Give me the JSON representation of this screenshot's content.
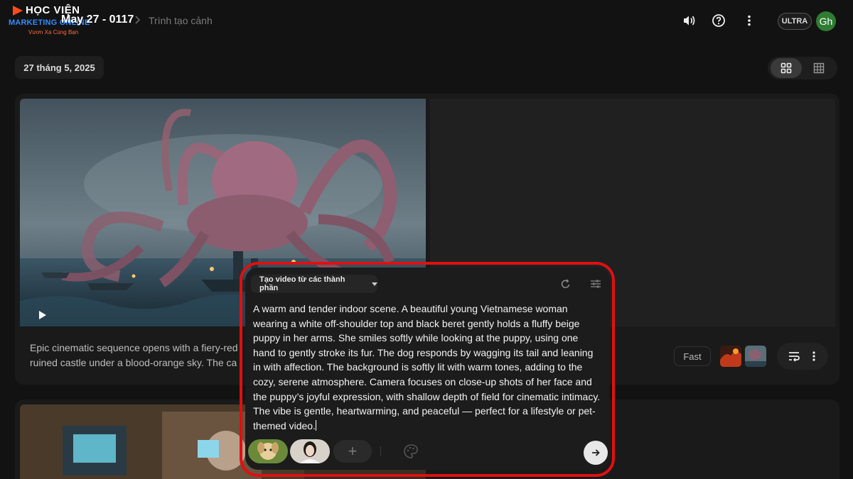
{
  "brand": {
    "line1": "HỌC VIỆN",
    "line2": "MARKETING ONLINE",
    "line3": "Vươn Xa Cùng Bạn"
  },
  "header": {
    "project_title": "May 27 - 0117",
    "page_title": "Trình tạo cảnh",
    "icons": [
      "volume-icon",
      "help-icon",
      "more-vert-icon"
    ],
    "plan_badge": "ULTRA",
    "avatar_initials": "Gh"
  },
  "toolbar": {
    "date_label": "27 tháng 5, 2025",
    "view_modes": [
      "grid-large-icon",
      "grid-small-icon"
    ],
    "active_view": "grid-large-icon"
  },
  "scene_card": {
    "description_line1": "Epic cinematic sequence opens with a fiery-red",
    "description_line2": "ruined castle under a blood-orange sky. The ca",
    "speed_label": "Fast",
    "actions": [
      "extend-icon",
      "more-vert-icon"
    ]
  },
  "composer": {
    "mode_label": "Tạo video từ các thành phần",
    "icons": [
      "refresh-icon",
      "tune-icon",
      "add-icon",
      "palette-icon",
      "send-arrow-icon"
    ],
    "add_label": "+",
    "prompt": "A warm and tender indoor scene. A beautiful young Vietnamese woman wearing a white off-shoulder top and black beret gently holds a fluffy beige puppy in her arms. She smiles softly while looking at the puppy, using one hand to gently stroke its fur. The dog responds by wagging its tail and leaning in with affection. The background is softly lit with warm tones, adding to the cozy, serene atmosphere. Camera focuses on close-up shots of her face and the puppy’s joyful expression, with shallow depth of field for cinematic intimacy. The vibe is gentle, heartwarming, and peaceful — perfect for a lifestyle or pet-themed video."
  },
  "colors": {
    "background": "#121212",
    "card": "#1a1a1a",
    "highlight_outline": "#e01010",
    "avatar": "#2e7d32",
    "brand_blue": "#2f8cff",
    "brand_orange": "#ff6a3d"
  }
}
